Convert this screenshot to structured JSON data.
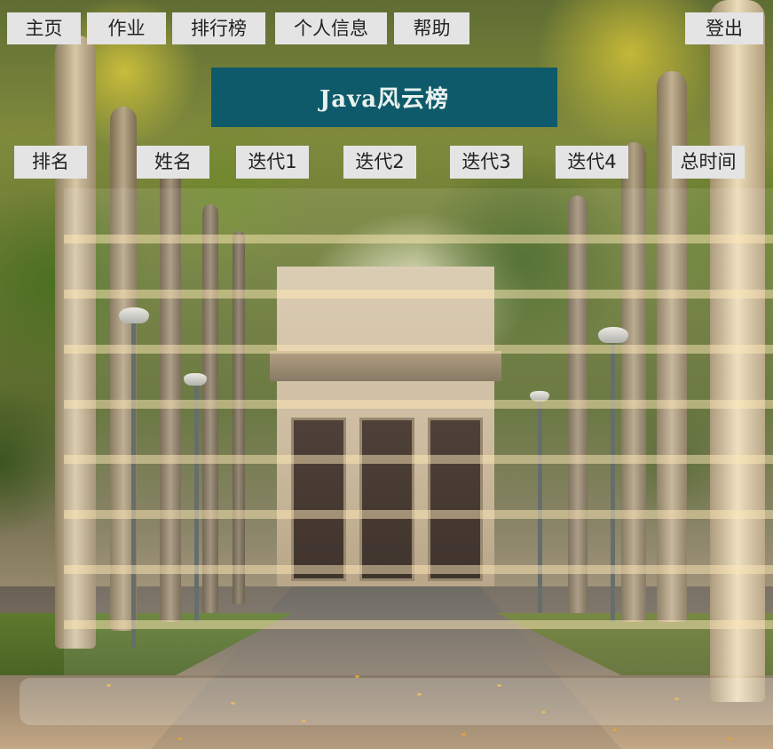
{
  "nav": {
    "home": "主页",
    "homework": "作业",
    "ranking": "排行榜",
    "profile": "个人信息",
    "help": "帮助",
    "logout": "登出"
  },
  "banner": {
    "title": "Java风云榜"
  },
  "table": {
    "columns": [
      "排名",
      "姓名",
      "迭代1",
      "迭代2",
      "迭代3",
      "迭代4",
      "总时间"
    ],
    "rows": []
  },
  "colors": {
    "banner_bg": "#0e5a6b",
    "button_bg": "#e4e4e4",
    "button_text": "#222222"
  }
}
